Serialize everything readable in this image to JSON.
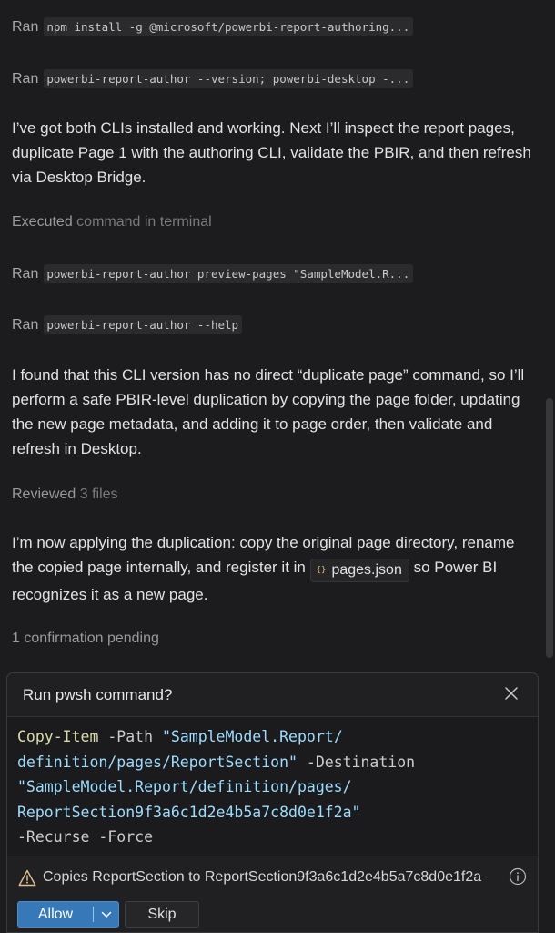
{
  "chat": {
    "ran_word": "Ran",
    "ran1_cmd": "npm install -g @microsoft/powerbi-report-authoring...",
    "ran2_cmd": "powerbi-report-author --version; powerbi-desktop -...",
    "para1": "I’ve got both CLIs installed and working. Next I’ll inspect the report pages, duplicate Page 1 with the authoring CLI, validate the PBIR, and then refresh via Desktop Bridge.",
    "executed_verb": "Executed",
    "executed_rest": "command in terminal",
    "ran3_cmd": "powerbi-report-author preview-pages \"SampleModel.R...",
    "ran4_cmd": "powerbi-report-author --help",
    "para2": "I found that this CLI version has no direct “duplicate page” command, so I’ll perform a safe PBIR-level duplication by copying the page folder, updating the new page metadata, and adding it to page order, then validate and refresh in Desktop.",
    "reviewed_verb": "Reviewed",
    "reviewed_rest": "3 files",
    "para3_before": "I’m now applying the duplication: copy the original page directory, rename the copied page internally, and register it in ",
    "file_chip_icon": "{}",
    "file_chip_label": "pages.json",
    "para3_after": " so Power BI recognizes it as a new page.",
    "pending": "1 confirmation pending"
  },
  "dialog": {
    "title": "Run pwsh command?",
    "code": {
      "cmd": "Copy-Item",
      "p1": " -Path ",
      "s1a": "\"SampleModel.Report/",
      "s1b": "definition/pages/ReportSection\"",
      "p2": " -Destination",
      "s2a": "\"SampleModel.Report/definition/pages/",
      "s2b": "ReportSection9f3a6c1d2e4b5a7c8d0e1f2a\"",
      "p3": "-Recurse -Force"
    },
    "warning": "Copies ReportSection to ReportSection9f3a6c1d2e4b5a7c8d0e1f2a",
    "allow_label": "Allow",
    "skip_label": "Skip"
  },
  "colors": {
    "accent": "#3778b8",
    "warning": "#e2c08d",
    "cmdlet": "#dcdcaa",
    "string": "#9cdcfe"
  }
}
